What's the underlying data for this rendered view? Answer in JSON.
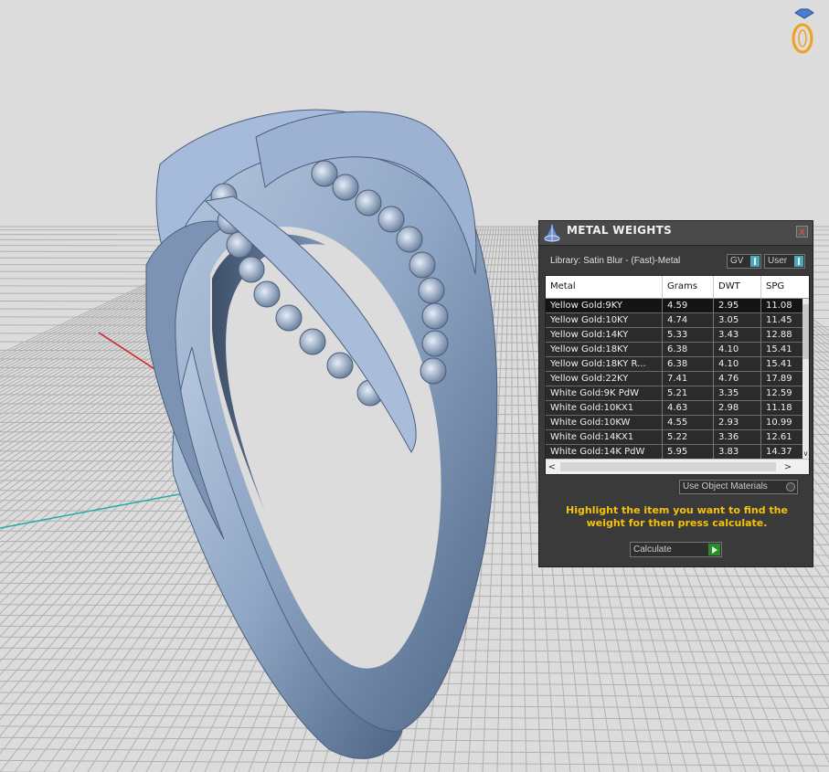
{
  "panel": {
    "title": "METAL WEIGHTS",
    "close_label": "x",
    "library_label": "Library: Satin Blur - (Fast)-Metal",
    "gv_label": "GV",
    "user_label": "User",
    "columns": [
      "Metal",
      "Grams",
      "DWT",
      "SPG"
    ],
    "rows": [
      {
        "metal": "Yellow Gold:9KY",
        "grams": "4.59",
        "dwt": "2.95",
        "spg": "11.08"
      },
      {
        "metal": "Yellow Gold:10KY",
        "grams": "4.74",
        "dwt": "3.05",
        "spg": "11.45"
      },
      {
        "metal": "Yellow Gold:14KY",
        "grams": "5.33",
        "dwt": "3.43",
        "spg": "12.88"
      },
      {
        "metal": "Yellow Gold:18KY",
        "grams": "6.38",
        "dwt": "4.10",
        "spg": "15.41"
      },
      {
        "metal": "Yellow Gold:18KY R...",
        "grams": "6.38",
        "dwt": "4.10",
        "spg": "15.41"
      },
      {
        "metal": "Yellow Gold:22KY",
        "grams": "7.41",
        "dwt": "4.76",
        "spg": "17.89"
      },
      {
        "metal": "White Gold:9K PdW",
        "grams": "5.21",
        "dwt": "3.35",
        "spg": "12.59"
      },
      {
        "metal": "White Gold:10KX1",
        "grams": "4.63",
        "dwt": "2.98",
        "spg": "11.18"
      },
      {
        "metal": "White Gold:10KW",
        "grams": "4.55",
        "dwt": "2.93",
        "spg": "10.99"
      },
      {
        "metal": "White Gold:14KX1",
        "grams": "5.22",
        "dwt": "3.36",
        "spg": "12.61"
      },
      {
        "metal": "White Gold:14K PdW",
        "grams": "5.95",
        "dwt": "3.83",
        "spg": "14.37"
      }
    ],
    "use_object_materials_label": "Use Object Materials",
    "hint": "Highlight the item you want to find the weight for then press calculate.",
    "calculate_label": "Calculate"
  },
  "icons": {
    "logo": "ring-logo-icon",
    "panel_icon": "metal-weights-icon",
    "scroll_down": "chevron-down-icon",
    "scroll_left": "chevron-left-icon",
    "scroll_right": "chevron-right-icon"
  },
  "colors": {
    "viewport_bg": "#dcdcdc",
    "grid_line": "#b0b0b0",
    "ring": "#8ea5c4",
    "axis_x": "#cc2222",
    "axis_y": "#22aaaa",
    "panel_bg": "#3a3a3a",
    "hint_text": "#f4c20d",
    "toggle_accent": "#4aa8b8",
    "calculate_accent": "#2d8a2d",
    "logo": "#f0a020"
  }
}
